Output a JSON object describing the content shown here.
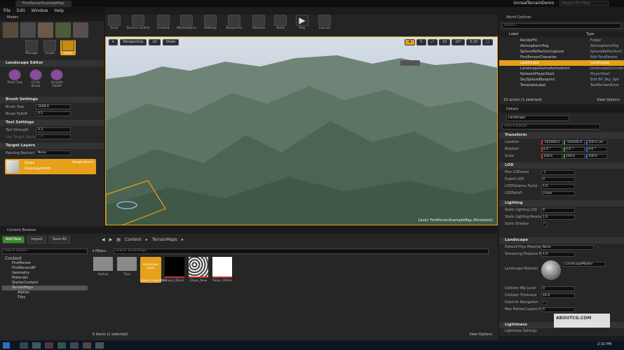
{
  "window": {
    "title": "FirstPersonExampleMap",
    "app_name": "UnrealTerrainDemo",
    "search_placeholder": "Search For Help"
  },
  "menu": [
    "File",
    "Edit",
    "Window",
    "Help"
  ],
  "modes": {
    "tab": "Modes",
    "labels": [
      "Manage",
      "Sculpt",
      "Paint"
    ]
  },
  "landscape_editor": {
    "title": "Landscape Editor",
    "tools": [
      "Paint Tool",
      "Circle Brush",
      "Smooth Falloff"
    ],
    "brush_settings": "Brush Settings",
    "brush_size_label": "Brush Size",
    "brush_size": "2048.0",
    "brush_falloff_label": "Brush Falloff",
    "brush_falloff": "0.5",
    "tool_settings": "Tool Settings",
    "tool_strength_label": "Tool Strength",
    "tool_strength": "0.3",
    "use_target_label": "Use Target Value",
    "use_target": "1.0",
    "target_layers": "Target Layers",
    "painting_restriction_label": "Painting Restrict",
    "painting_restriction": "None",
    "layer_name": "Grass",
    "layer_info": "GrassLayerInfo",
    "weight_blend": "Weight-Blend"
  },
  "toolbar": [
    "Save",
    "Source Control",
    "Content",
    "Marketplace",
    "Settings",
    "Blueprints",
    "Matinee",
    "Build",
    "Play",
    "Launch"
  ],
  "viewport": {
    "perspective": "Perspective",
    "lit": "Lit",
    "show": "Show",
    "grid": "10",
    "angle": "10°",
    "scale": "0.25",
    "level_text": "Level: FirstPersonExampleMap (Persistent)"
  },
  "outliner": {
    "tab": "World Outliner",
    "search": "Search...",
    "col_label": "Label",
    "col_type": "Type",
    "rows": [
      {
        "label": "RenderFX",
        "type": "Folder"
      },
      {
        "label": "AtmosphericFog",
        "type": "AtmosphericFog"
      },
      {
        "label": "SphereReflectionCapture",
        "type": "SphereReflectionC"
      },
      {
        "label": "FirstPersonCharacter",
        "type": "Edit FirstPerson"
      },
      {
        "label": "Landscape",
        "type": "Landscape"
      },
      {
        "label": "LandscapeGizmoActiveActor",
        "type": "LandscapeGizmoAc"
      },
      {
        "label": "NetworkPlayerStart",
        "type": "PlayerStart"
      },
      {
        "label": "SkySphereBlueprint",
        "type": "Edit BP_Sky_Sph"
      },
      {
        "label": "TemplateLabel",
        "type": "TextRenderActor"
      }
    ],
    "count": "33 actors (1 selected)",
    "view_options": "View Options"
  },
  "details": {
    "tab": "Details",
    "name": "Landscape",
    "search": "Search Details",
    "transform": "Transform",
    "location_label": "Location",
    "location": [
      "-101600.0",
      "-101600.0",
      "100.0 cm"
    ],
    "rotation_label": "Rotation",
    "rotation": [
      "0.0 °",
      "0.0 °",
      "0.0 °"
    ],
    "scale_label": "Scale",
    "scale": [
      "100.0",
      "100.0",
      "100.0"
    ],
    "lod": "LOD",
    "lod_rows": [
      {
        "label": "Max LODLevel",
        "value": "-1"
      },
      {
        "label": "Export LOD",
        "value": "0"
      },
      {
        "label": "LODDistance Factor",
        "value": "1.0"
      },
      {
        "label": "LODFalloff",
        "value": "Linear"
      }
    ],
    "lighting": "Lighting",
    "lighting_rows": [
      {
        "label": "Static Lighting LOD",
        "value": "0"
      },
      {
        "label": "Static Lighting Resolu",
        "value": "1.0"
      },
      {
        "label": "Static Shadow",
        "value": "✓"
      }
    ],
    "landscape": "Landscape",
    "landscape_rows": [
      {
        "label": "Default Phys Material",
        "value": "None"
      },
      {
        "label": "Streaming Distance M",
        "value": "1.0"
      }
    ],
    "landscape_material_label": "Landscape Material",
    "landscape_material": "LandscapeMaster",
    "collision_rows": [
      {
        "label": "Collision Mip Level",
        "value": "0"
      },
      {
        "label": "Collision Thickness",
        "value": "16.0"
      },
      {
        "label": "Used for Navigation",
        "value": "✓"
      },
      {
        "label": "Max Painted Layers P",
        "value": "0"
      }
    ],
    "lightmass": "Lightmass",
    "lightmass_settings": "Lightmass Settings"
  },
  "content_browser": {
    "tab": "Content Browser",
    "add_new": "Add New",
    "import": "Import",
    "save_all": "Save All",
    "path": [
      "Content",
      "TerrainMaps"
    ],
    "search_folders": "Search Folders",
    "filters": "Filters",
    "search_assets": "Search TerrainMaps",
    "tree": [
      "Content",
      "FirstPerson",
      "FirstPersonBP",
      "Geometry",
      "Materials",
      "StarterContent",
      "TerrainMaps",
      "Alphas",
      "Tiles"
    ],
    "assets": [
      {
        "name": "Alphas",
        "kind": "folder"
      },
      {
        "name": "Tiles",
        "kind": "folder"
      },
      {
        "name": "Grass_LayerInfo",
        "kind": "layer"
      },
      {
        "name": "Slope_Black",
        "kind": "black"
      },
      {
        "name": "Slope_New",
        "kind": "noise"
      },
      {
        "name": "Slope_White",
        "kind": "white"
      }
    ],
    "layer_thumb_text": "Landscape Layer",
    "status": "6 items (1 selected)",
    "view_options": "View Options"
  },
  "taskbar": {
    "time": "2:32 PM"
  },
  "watermark": {
    "site": "ABOUTCG.COM"
  },
  "colors": {
    "accent": "#e6a019",
    "selection": "#ff8c1a",
    "link": "#7fb4e6"
  }
}
